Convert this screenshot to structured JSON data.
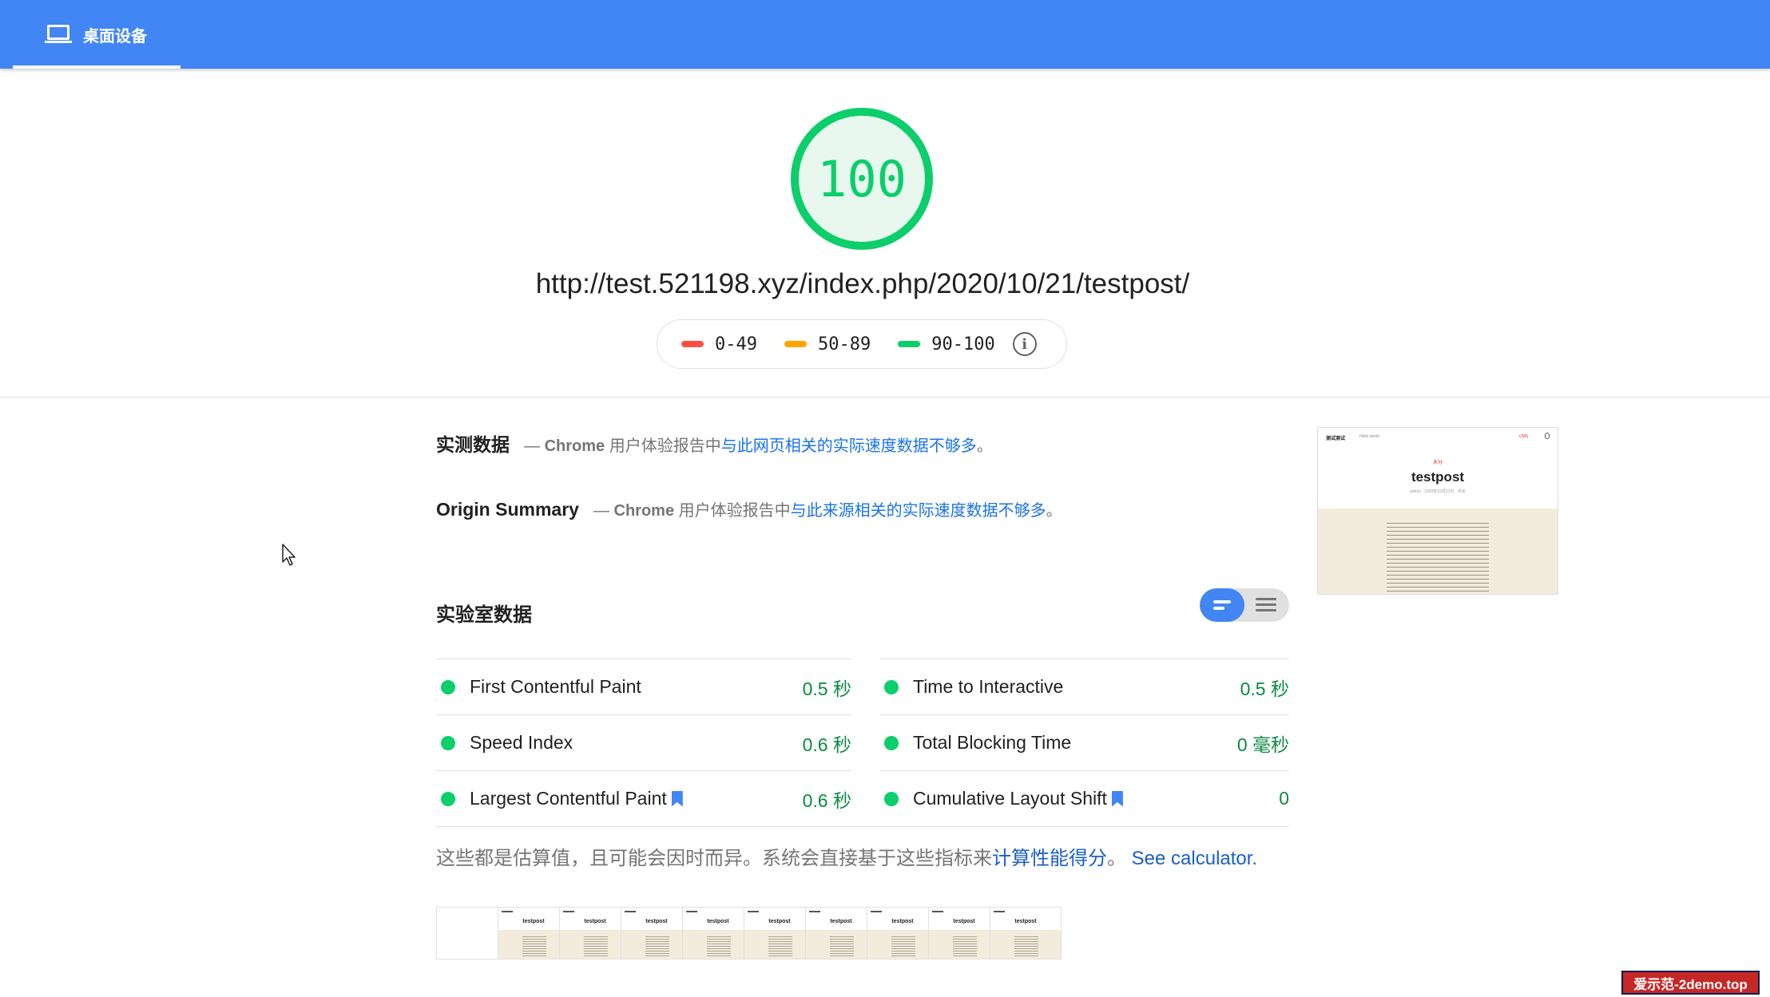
{
  "tab": {
    "label": "桌面设备",
    "icon": "laptop-icon"
  },
  "score": {
    "value": "100",
    "fraction": 1.0,
    "color": "#0cce6b"
  },
  "url": "http://test.521198.xyz/index.php/2020/10/21/testpost/",
  "legend": {
    "ranges": [
      {
        "label": "0-49",
        "color": "#ff4e42"
      },
      {
        "label": "50-89",
        "color": "#ffa400"
      },
      {
        "label": "90-100",
        "color": "#0cce6b"
      }
    ],
    "info_icon": "info-icon"
  },
  "field_data": {
    "title": "实测数据",
    "dash": "—",
    "source": "Chrome",
    "text": "用户体验报告中",
    "link": "与此网页相关的实际速度数据不够多",
    "end": "。"
  },
  "origin_summary": {
    "title": "Origin Summary",
    "dash": "—",
    "source": "Chrome",
    "text": "用户体验报告中",
    "link": "与此来源相关的实际速度数据不够多",
    "end": "。"
  },
  "lab": {
    "title": "实验室数据",
    "metrics": [
      {
        "name": "First Contentful Paint",
        "value": "0.5 秒",
        "bookmark": false
      },
      {
        "name": "Time to Interactive",
        "value": "0.5 秒",
        "bookmark": false
      },
      {
        "name": "Speed Index",
        "value": "0.6 秒",
        "bookmark": false
      },
      {
        "name": "Total Blocking Time",
        "value": "0 毫秒",
        "bookmark": false
      },
      {
        "name": "Largest Contentful Paint",
        "value": "0.6 秒",
        "bookmark": true
      },
      {
        "name": "Cumulative Layout Shift",
        "value": "0",
        "bookmark": true
      }
    ]
  },
  "note": {
    "text": "这些都是估算值，且可能会因时而异。系统会直接基于这些指标来",
    "link": "计算性能得分",
    "mid": "。",
    "calculator": "See calculator."
  },
  "filmstrip": {
    "frame_title": "testpost",
    "frame_count": 10
  },
  "screenshot": {
    "site_name": "测试测试",
    "nav_text": "Hello world",
    "nav_red": "CMS",
    "category": "未分",
    "title": "testpost",
    "meta": "admin · 2020年10月21日 · 评论"
  },
  "watermark": "爱示范-2demo.top"
}
